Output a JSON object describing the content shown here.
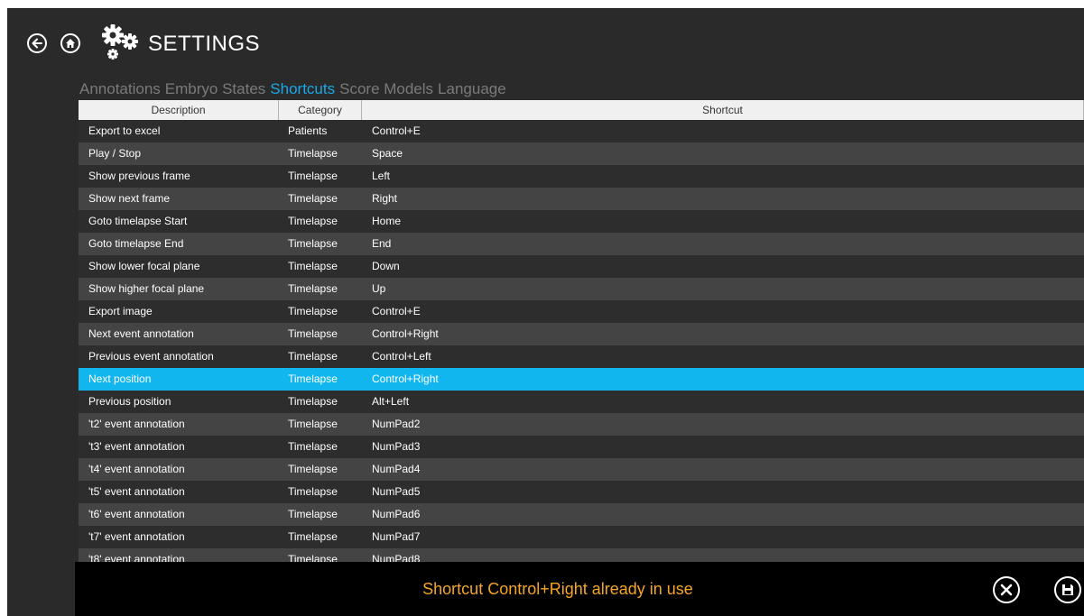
{
  "header": {
    "title": "SETTINGS",
    "back_icon": "back-arrow-icon",
    "home_icon": "home-icon",
    "settings_icon": "gears-icon"
  },
  "tabs": [
    {
      "label": "Annotations",
      "active": false
    },
    {
      "label": "Embryo States",
      "active": false
    },
    {
      "label": "Shortcuts",
      "active": true
    },
    {
      "label": "Score Models",
      "active": false
    },
    {
      "label": "Language",
      "active": false
    }
  ],
  "table": {
    "columns": [
      "Description",
      "Category",
      "Shortcut"
    ],
    "rows": [
      {
        "description": "Export to excel",
        "category": "Patients",
        "shortcut": "Control+E"
      },
      {
        "description": "Play / Stop",
        "category": "Timelapse",
        "shortcut": "Space"
      },
      {
        "description": "Show previous frame",
        "category": "Timelapse",
        "shortcut": "Left"
      },
      {
        "description": "Show next frame",
        "category": "Timelapse",
        "shortcut": "Right"
      },
      {
        "description": "Goto timelapse Start",
        "category": "Timelapse",
        "shortcut": "Home"
      },
      {
        "description": "Goto timelapse End",
        "category": "Timelapse",
        "shortcut": "End"
      },
      {
        "description": "Show lower focal plane",
        "category": "Timelapse",
        "shortcut": "Down"
      },
      {
        "description": "Show higher focal plane",
        "category": "Timelapse",
        "shortcut": "Up"
      },
      {
        "description": "Export image",
        "category": "Timelapse",
        "shortcut": "Control+E"
      },
      {
        "description": "Next event annotation",
        "category": "Timelapse",
        "shortcut": "Control+Right"
      },
      {
        "description": "Previous event annotation",
        "category": "Timelapse",
        "shortcut": "Control+Left"
      },
      {
        "description": "Next position",
        "category": "Timelapse",
        "shortcut": "Control+Right"
      },
      {
        "description": "Previous position",
        "category": "Timelapse",
        "shortcut": "Alt+Left"
      },
      {
        "description": "'t2' event annotation",
        "category": "Timelapse",
        "shortcut": "NumPad2"
      },
      {
        "description": "'t3' event annotation",
        "category": "Timelapse",
        "shortcut": "NumPad3"
      },
      {
        "description": "'t4' event annotation",
        "category": "Timelapse",
        "shortcut": "NumPad4"
      },
      {
        "description": "'t5' event annotation",
        "category": "Timelapse",
        "shortcut": "NumPad5"
      },
      {
        "description": "'t6' event annotation",
        "category": "Timelapse",
        "shortcut": "NumPad6"
      },
      {
        "description": "'t7' event annotation",
        "category": "Timelapse",
        "shortcut": "NumPad7"
      },
      {
        "description": "'t8' event annotation",
        "category": "Timelapse",
        "shortcut": "NumPad8"
      }
    ],
    "selected_index": 11
  },
  "status": {
    "message": "Shortcut Control+Right already in use",
    "cancel_icon": "close-circle-icon",
    "save_icon": "save-disk-icon"
  },
  "colors": {
    "background": "#2a2a2a",
    "accent": "#1aa7e8",
    "selected_row": "#12b6ee",
    "warning_text": "#f5a623"
  }
}
